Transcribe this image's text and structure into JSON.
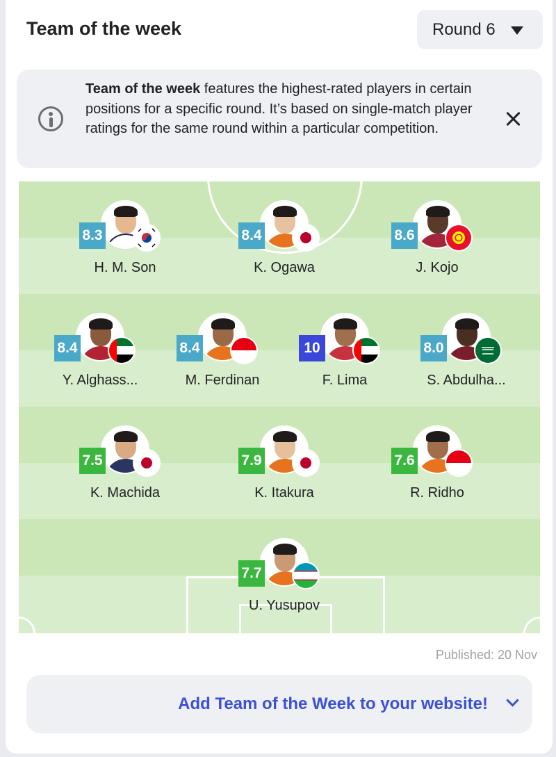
{
  "header": {
    "title": "Team of the week",
    "round_label": "Round 6"
  },
  "info": {
    "bold": "Team of the week",
    "text": " features the highest-rated players in certain positions for a specific round. It’s based on single-match player ratings for the same round within a particular competition."
  },
  "colors": {
    "rating_blue": "#4aa8c8",
    "rating_green": "#3bb73f",
    "rating_top": "#3b47d8",
    "link": "#3b50d4"
  },
  "players": [
    {
      "name": "H. M. Son",
      "rating": "8.3",
      "flag": "south-korea-flag"
    },
    {
      "name": "K. Ogawa",
      "rating": "8.4",
      "flag": "japan-flag"
    },
    {
      "name": "J. Kojo",
      "rating": "8.6",
      "flag": "kyrgyzstan-flag"
    },
    {
      "name": "Y. Alghass...",
      "rating": "8.4",
      "flag": "uae-flag"
    },
    {
      "name": "M. Ferdinan",
      "rating": "8.4",
      "flag": "indonesia-flag"
    },
    {
      "name": "F. Lima",
      "rating": "10",
      "flag": "uae-flag"
    },
    {
      "name": "S. Abdulha...",
      "rating": "8.0",
      "flag": "saudi-arabia-flag"
    },
    {
      "name": "K. Machida",
      "rating": "7.5",
      "flag": "japan-flag"
    },
    {
      "name": "K. Itakura",
      "rating": "7.9",
      "flag": "japan-flag"
    },
    {
      "name": "R. Ridho",
      "rating": "7.6",
      "flag": "indonesia-flag"
    },
    {
      "name": "U. Yusupov",
      "rating": "7.7",
      "flag": "uzbekistan-flag"
    }
  ],
  "footer": {
    "published": "Published: 20 Nov",
    "embed_label": "Add Team of the Week to your website!"
  }
}
